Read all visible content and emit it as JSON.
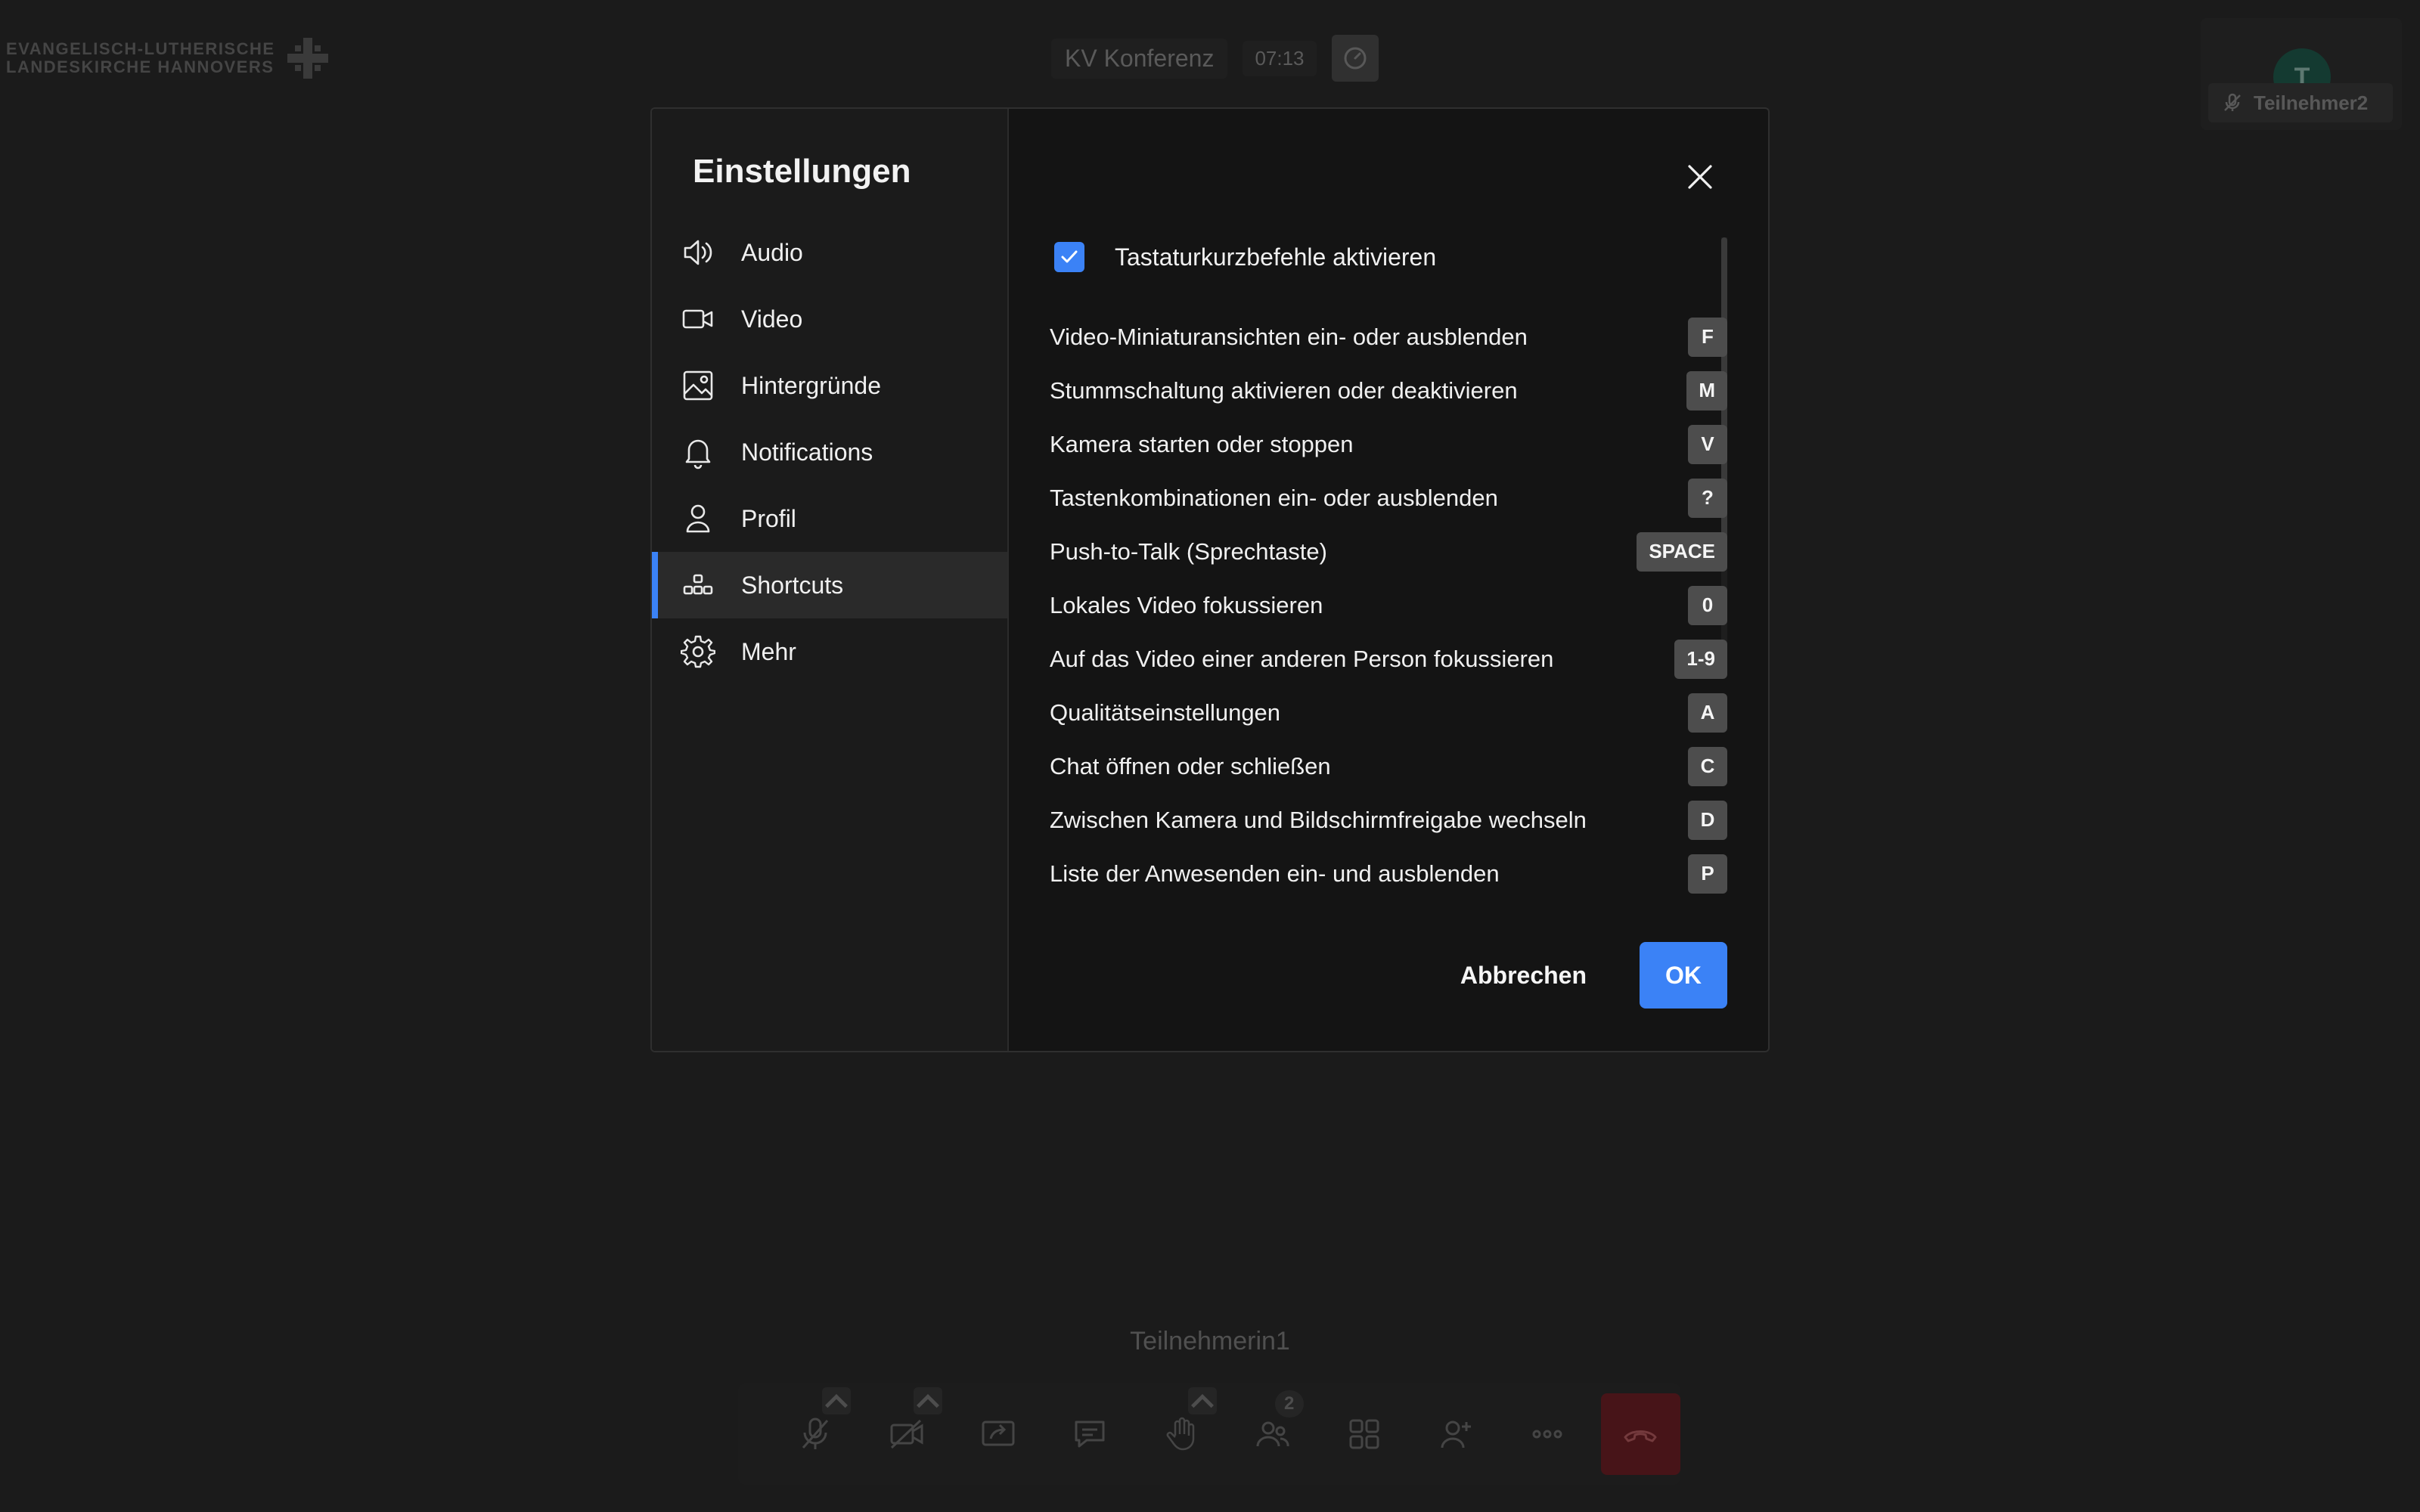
{
  "branding": {
    "logo_line1": "EVANGELISCH-LUTHERISCHE",
    "logo_line2": "LANDESKIRCHE HANNOVERS"
  },
  "conference": {
    "title": "KV Konferenz",
    "time": "07:13"
  },
  "remote_participant": {
    "avatar_initial": "T",
    "name": "Teilnehmer2",
    "muted": true
  },
  "local_participant": {
    "name": "Teilnehmerin1"
  },
  "toolbar": {
    "participants_badge": "2",
    "buttons": [
      "microphone-muted-icon",
      "camera-off-icon",
      "share-screen-icon",
      "chat-icon",
      "raise-hand-icon",
      "participants-icon",
      "tile-view-icon",
      "invite-icon",
      "more-icon",
      "hangup-icon"
    ]
  },
  "dialog": {
    "title": "Einstellungen",
    "nav": [
      {
        "label": "Audio",
        "icon": "speaker-icon",
        "active": false
      },
      {
        "label": "Video",
        "icon": "video-camera-icon",
        "active": false
      },
      {
        "label": "Hintergründe",
        "icon": "image-icon",
        "active": false
      },
      {
        "label": "Notifications",
        "icon": "bell-icon",
        "active": false
      },
      {
        "label": "Profil",
        "icon": "user-icon",
        "active": false
      },
      {
        "label": "Shortcuts",
        "icon": "shortcuts-icon",
        "active": true
      },
      {
        "label": "Mehr",
        "icon": "gear-icon",
        "active": false
      }
    ],
    "enable_shortcuts": {
      "label": "Tastaturkurzbefehle aktivieren",
      "checked": true
    },
    "shortcuts": [
      {
        "label": "Video-Miniaturansichten ein- oder ausblenden",
        "key": "F"
      },
      {
        "label": "Stummschaltung aktivieren oder deaktivieren",
        "key": "M"
      },
      {
        "label": "Kamera starten oder stoppen",
        "key": "V"
      },
      {
        "label": "Tastenkombinationen ein- oder ausblenden",
        "key": "?"
      },
      {
        "label": "Push-to-Talk (Sprechtaste)",
        "key": "SPACE"
      },
      {
        "label": "Lokales Video fokussieren",
        "key": "0"
      },
      {
        "label": "Auf das Video einer anderen Person fokussieren",
        "key": "1-9"
      },
      {
        "label": "Qualitätseinstellungen",
        "key": "A"
      },
      {
        "label": "Chat öffnen oder schließen",
        "key": "C"
      },
      {
        "label": "Zwischen Kamera und Bildschirmfreigabe wechseln",
        "key": "D"
      },
      {
        "label": "Liste der Anwesenden ein- und ausblenden",
        "key": "P"
      }
    ],
    "cancel_label": "Abbrechen",
    "ok_label": "OK"
  },
  "colors": {
    "accent": "#3b82f6",
    "hangup": "#6e2025"
  }
}
